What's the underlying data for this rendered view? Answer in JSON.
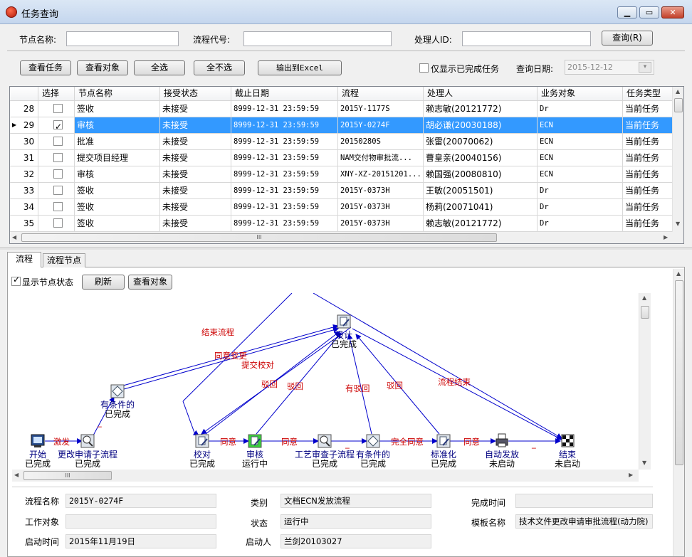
{
  "window": {
    "title": "任务查询"
  },
  "query": {
    "node_name_label": "节点名称:",
    "node_name_value": "",
    "flow_code_label": "流程代号:",
    "flow_code_value": "",
    "handler_label": "处理人ID:",
    "handler_value": "",
    "search_button": "查询(R)"
  },
  "toolbar": {
    "view_task": "查看任务",
    "view_object": "查看对象",
    "select_all": "全选",
    "select_none": "全不选",
    "export_excel": "输出到Excel",
    "only_completed": "仅显示已完成任务",
    "query_date_label": "查询日期:",
    "query_date_value": "2015-12-12"
  },
  "grid": {
    "columns": [
      "选择",
      "节点名称",
      "接受状态",
      "截止日期",
      "流程",
      "处理人",
      "业务对象",
      "任务类型"
    ],
    "rows": [
      {
        "num": "28",
        "checked": false,
        "selected": false,
        "node": "签收",
        "status": "未接受",
        "deadline": "8999-12-31 23:59:59",
        "flow": "2015Y-1177S",
        "handler": "赖志敏(20121772)",
        "object": "Dr",
        "type": "当前任务"
      },
      {
        "num": "29",
        "checked": true,
        "selected": true,
        "node": "审核",
        "status": "未接受",
        "deadline": "8999-12-31 23:59:59",
        "flow": "2015Y-0274F",
        "handler": "胡必谦(20030188)",
        "object": "ECN",
        "type": "当前任务"
      },
      {
        "num": "30",
        "checked": false,
        "selected": false,
        "node": "批准",
        "status": "未接受",
        "deadline": "8999-12-31 23:59:59",
        "flow": "20150280S",
        "handler": "张雷(20070062)",
        "object": "ECN",
        "type": "当前任务"
      },
      {
        "num": "31",
        "checked": false,
        "selected": false,
        "node": "提交项目经理",
        "status": "未接受",
        "deadline": "8999-12-31 23:59:59",
        "flow": "NAM交付物审批流...",
        "handler": "曹皇亲(20040156)",
        "object": "ECN",
        "type": "当前任务"
      },
      {
        "num": "32",
        "checked": false,
        "selected": false,
        "node": "审核",
        "status": "未接受",
        "deadline": "8999-12-31 23:59:59",
        "flow": "XNY-XZ-20151201...",
        "handler": "赖国强(20080810)",
        "object": "ECN",
        "type": "当前任务"
      },
      {
        "num": "33",
        "checked": false,
        "selected": false,
        "node": "签收",
        "status": "未接受",
        "deadline": "8999-12-31 23:59:59",
        "flow": "2015Y-0373H",
        "handler": "王敏(20051501)",
        "object": "Dr",
        "type": "当前任务"
      },
      {
        "num": "34",
        "checked": false,
        "selected": false,
        "node": "签收",
        "status": "未接受",
        "deadline": "8999-12-31 23:59:59",
        "flow": "2015Y-0373H",
        "handler": "杨莉(20071041)",
        "object": "Dr",
        "type": "当前任务"
      },
      {
        "num": "35",
        "checked": false,
        "selected": false,
        "node": "签收",
        "status": "未接受",
        "deadline": "8999-12-31 23:59:59",
        "flow": "2015Y-0373H",
        "handler": "赖志敏(20121772)",
        "object": "Dr",
        "type": "当前任务"
      }
    ],
    "hscroll_grip": "III"
  },
  "tabs": [
    "流程",
    "流程节点"
  ],
  "flow_panel": {
    "show_status": "显示节点状态",
    "refresh": "刷新",
    "view_object": "查看对象",
    "hscroll_grip": "III",
    "nodes": [
      {
        "id": "start",
        "name": "开始",
        "state": "已完成",
        "icon": "monitor-icon"
      },
      {
        "id": "change-sub",
        "name": "更改申请子流程",
        "state": "已完成",
        "icon": "subflow-icon"
      },
      {
        "id": "cond1",
        "name": "有条件的",
        "state": "已完成",
        "icon": "diamond-icon"
      },
      {
        "id": "check",
        "name": "校对",
        "state": "已完成",
        "icon": "task-icon"
      },
      {
        "id": "review",
        "name": "审核",
        "state": "运行中",
        "icon": "task-running-icon"
      },
      {
        "id": "craft-sub",
        "name": "工艺审查子流程",
        "state": "已完成",
        "icon": "subflow-icon"
      },
      {
        "id": "cond2",
        "name": "有条件的",
        "state": "已完成",
        "icon": "diamond-icon"
      },
      {
        "id": "standard",
        "name": "标准化",
        "state": "已完成",
        "icon": "task-icon"
      },
      {
        "id": "auto",
        "name": "自动发放",
        "state": "未启动",
        "icon": "printer-icon"
      },
      {
        "id": "end",
        "name": "结束",
        "state": "未启动",
        "icon": "flag-icon"
      },
      {
        "id": "design",
        "name": "设计",
        "state": "已完成",
        "icon": "task-icon"
      }
    ],
    "edge_labels": [
      "激发",
      "_",
      "同意",
      "同意",
      "_",
      "完全同意",
      "同意",
      "_",
      "结束流程",
      "同意变更",
      "提交校对",
      "驳回",
      "驳回",
      "有驳回",
      "驳回",
      "流程结束"
    ]
  },
  "info": {
    "flow_name_label": "流程名称",
    "flow_name": "2015Y-0274F",
    "category_label": "类别",
    "category": "文档ECN发放流程",
    "finish_time_label": "完成时间",
    "finish_time": "",
    "work_object_label": "工作对象",
    "work_object": "",
    "state_label": "状态",
    "state": "运行中",
    "template_label": "模板名称",
    "template": "技术文件更改申请审批流程(动力院)",
    "start_time_label": "启动时间",
    "start_time": "2015年11月19日",
    "starter_label": "启动人",
    "starter": "兰剑20103027"
  },
  "colors": {
    "selection": "#3399ff",
    "edge": "#0000cc",
    "edge_label": "#cc0000",
    "node_label": "#000080"
  }
}
